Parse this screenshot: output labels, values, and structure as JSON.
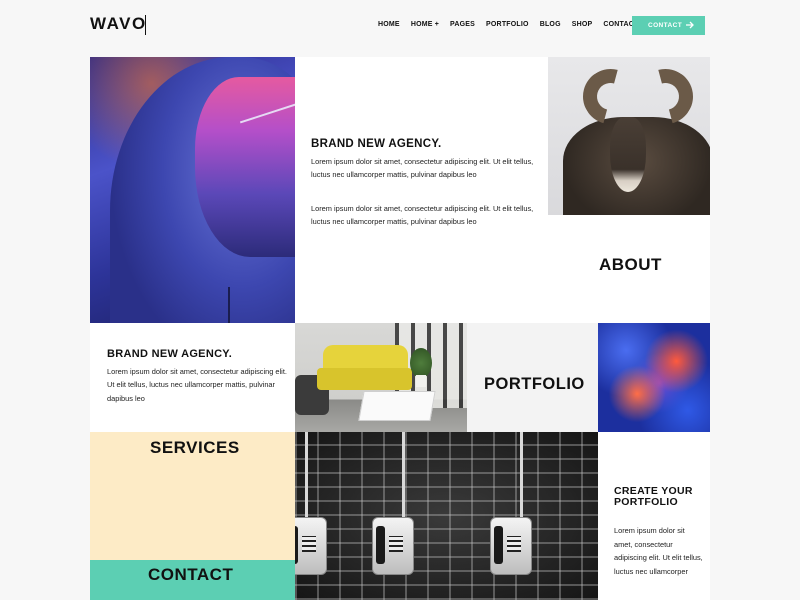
{
  "header": {
    "logo": "WAVO",
    "nav": [
      "HOME",
      "HOME +",
      "PAGES",
      "PORTFOLIO",
      "BLOG",
      "SHOP",
      "CONTACT"
    ],
    "cta_label": "CONTACT"
  },
  "intro": {
    "title": "BRAND NEW AGENCY.",
    "paragraph1": "Lorem ipsum dolor sit amet, consectetur adipiscing elit. Ut elit tellus, luctus nec ullamcorper mattis, pulvinar dapibus leo",
    "paragraph2": "Lorem ipsum dolor sit amet, consectetur adipiscing elit. Ut elit tellus, luctus nec ullamcorper mattis, pulvinar dapibus leo"
  },
  "about": {
    "label": "ABOUT"
  },
  "brand2": {
    "title": "BRAND NEW AGENCY.",
    "paragraph": "Lorem ipsum dolor sit amet, consectetur adipiscing elit. Ut elit tellus, luctus nec ullamcorper mattis, pulvinar dapibus leo"
  },
  "portfolio": {
    "label": "PORTFOLIO"
  },
  "services": {
    "label": "SERVICES"
  },
  "contact": {
    "label": "CONTACT"
  },
  "create": {
    "title": "CREATE YOUR PORTFOLIO",
    "paragraph": "Lorem ipsum dolor sit amet, consectetur adipiscing elit. Ut elit tellus, luctus nec ullamcorper"
  },
  "colors": {
    "accent": "#5ccfb3",
    "services_bg": "#fdebc6",
    "page_bg": "#f7f7f7"
  },
  "icons": {
    "cta": "arrow-right-icon"
  }
}
